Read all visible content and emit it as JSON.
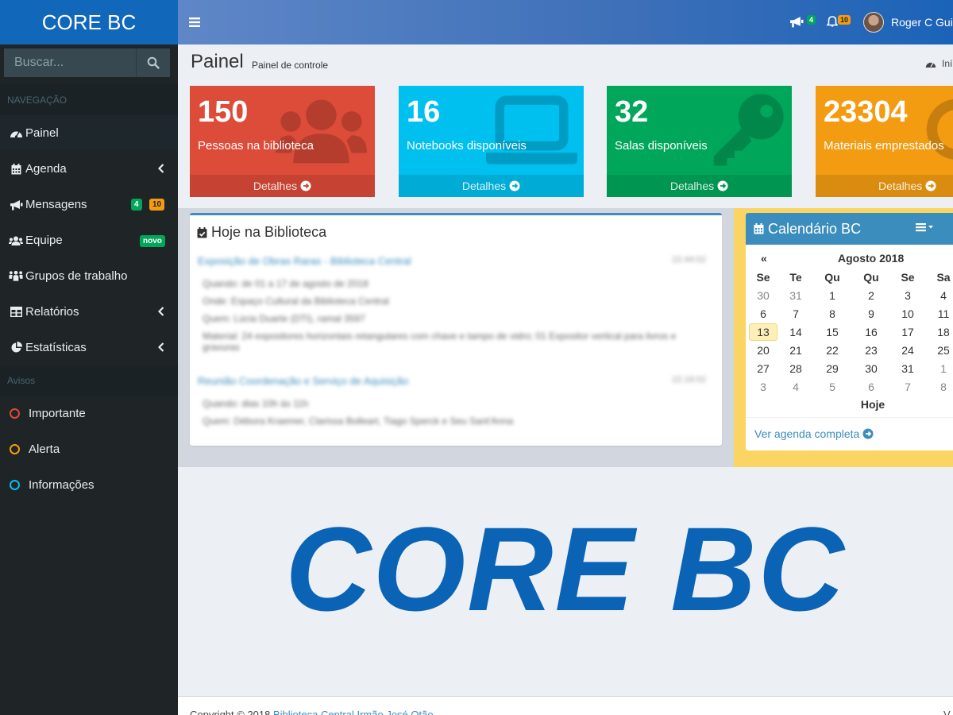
{
  "brand": "CORE BC",
  "search": {
    "placeholder": "Buscar..."
  },
  "sidebar": {
    "nav_header": "NAVEGAÇÃO",
    "items": [
      {
        "label": "Painel",
        "icon": "dashboard-icon"
      },
      {
        "label": "Agenda",
        "icon": "calendar-icon"
      },
      {
        "label": "Mensagens",
        "icon": "bullhorn-icon",
        "badge_green": "4",
        "badge_yellow": "10"
      },
      {
        "label": "Equipe",
        "icon": "users-icon",
        "badge_new": "novo"
      },
      {
        "label": "Grupos de trabalho",
        "icon": "group-icon"
      },
      {
        "label": "Relatórios",
        "icon": "table-icon"
      },
      {
        "label": "Estatísticas",
        "icon": "pie-chart-icon"
      }
    ],
    "notices_header": "Avisos",
    "notices": [
      {
        "label": "Importante",
        "color": "#dd4b39"
      },
      {
        "label": "Alerta",
        "color": "#f39c12"
      },
      {
        "label": "Informações",
        "color": "#00c0ef"
      }
    ]
  },
  "topbar": {
    "announcements_count": "4",
    "notifications_count": "10",
    "user_name": "Roger C Gui"
  },
  "header": {
    "title": "Painel",
    "subtitle": "Painel de controle",
    "breadcrumb": "Iní"
  },
  "stats": [
    {
      "value": "150",
      "label": "Pessoas na biblioteca",
      "footer": "Detalhes",
      "color": "#dd4b39",
      "icon": "users-icon"
    },
    {
      "value": "16",
      "label": "Notebooks disponíveis",
      "footer": "Detalhes",
      "color": "#00c0ef",
      "icon": "laptop-icon"
    },
    {
      "value": "32",
      "label": "Salas disponíveis",
      "footer": "Detalhes",
      "color": "#00a65a",
      "icon": "key-icon"
    },
    {
      "value": "23304",
      "label": "Materiais emprestados",
      "footer": "Detalhes",
      "color": "#f39c12",
      "icon": "refresh-icon"
    }
  ],
  "today": {
    "title": "Hoje na Biblioteca",
    "events": [
      {
        "title": "Exposição de Obras Raras - Biblioteca Central",
        "time": "22:44:02",
        "lines": [
          "Quando: de 01 a 17 de agosto de 2018",
          "Onde: Espaço Cultural da Biblioteca Central",
          "Quem: Lúcia Duarte (DTI), ramal 3597",
          "Material: 24 expositores horizontais retangulares com chave e tampo de vidro; 01 Expositor vertical para livros e gravuras"
        ]
      },
      {
        "title": "Reunião Coordenação e Serviço de Aquisição",
        "time": "22:16:02",
        "lines": [
          "Quando: dias 10h às 11h",
          "Quem: Débora Kraemer, Clarissa Bolleart, Tiago Sperck e Seu Sant'Anna"
        ]
      }
    ]
  },
  "calendar": {
    "title": "Calendário BC",
    "prev": "«",
    "month": "Agosto 2018",
    "weekdays": [
      "Se",
      "Te",
      "Qu",
      "Qu",
      "Se",
      "Sa"
    ],
    "weeks": [
      [
        "30",
        "31",
        "1",
        "2",
        "3",
        "4"
      ],
      [
        "6",
        "7",
        "8",
        "9",
        "10",
        "11"
      ],
      [
        "13",
        "14",
        "15",
        "16",
        "17",
        "18"
      ],
      [
        "20",
        "21",
        "22",
        "23",
        "24",
        "25"
      ],
      [
        "27",
        "28",
        "29",
        "30",
        "31",
        "1"
      ],
      [
        "3",
        "4",
        "5",
        "6",
        "7",
        "8"
      ]
    ],
    "today_label": "Hoje",
    "link": "Ver agenda completa"
  },
  "watermark": "CORE BC",
  "footer": {
    "copyright": "Copyright © 2018 ",
    "link": "Biblioteca Central Irmão José Otão",
    "right": "V"
  }
}
